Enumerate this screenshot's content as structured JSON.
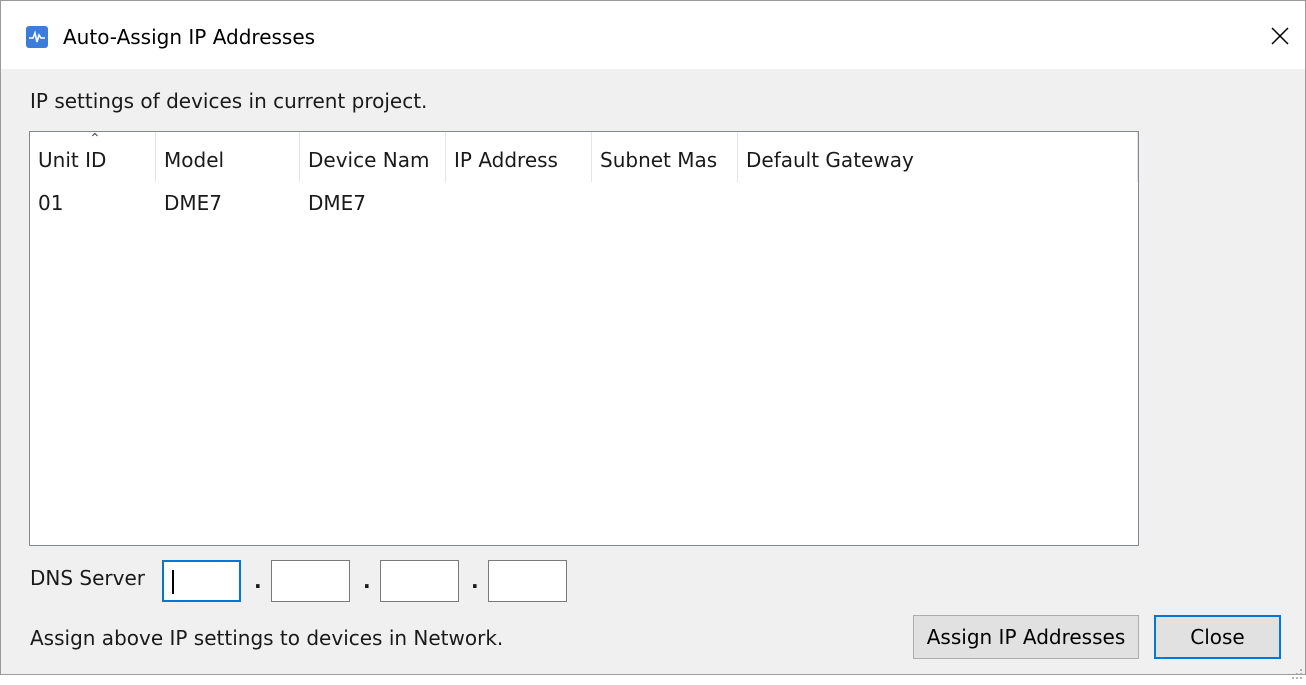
{
  "window": {
    "title": "Auto-Assign IP Addresses",
    "app_icon": "app-icon",
    "close_icon": "close-icon"
  },
  "caption": "IP settings of devices in current project.",
  "table": {
    "sort_column": "Unit ID",
    "sort_direction": "ascending",
    "columns": [
      "Unit ID",
      "Model",
      "Device Nam",
      "IP Address",
      "Subnet Mas",
      "Default Gateway"
    ],
    "rows": [
      [
        "01",
        "DME7",
        "DME7",
        "",
        "",
        ""
      ]
    ]
  },
  "dns": {
    "label": "DNS Server",
    "octets": [
      "",
      "",
      "",
      ""
    ],
    "separator": "."
  },
  "footer": {
    "text": "Assign above IP settings to devices in Network.",
    "assign_label": "Assign IP Addresses",
    "close_label": "Close"
  },
  "colors": {
    "accent": "#0078d7",
    "button_bg": "#e1e1e1",
    "dialog_bg": "#f0f0f0"
  }
}
